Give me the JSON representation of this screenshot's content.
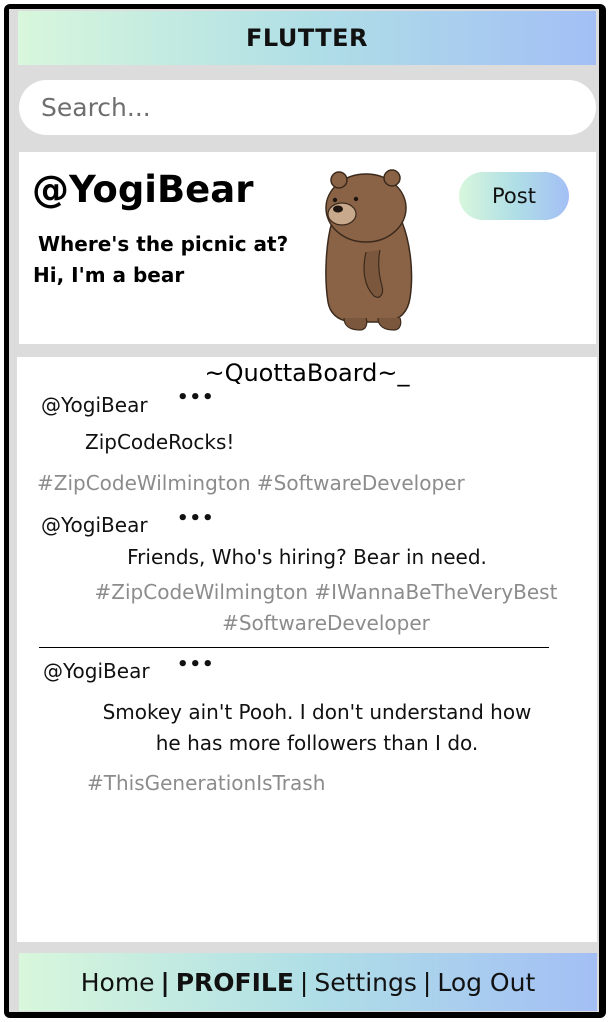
{
  "app": {
    "title": "FLUTTER"
  },
  "search": {
    "placeholder": "Search..."
  },
  "profile": {
    "handle": "@YogiBear",
    "bio_line1": "Where's the picnic at?",
    "bio_line2": "Hi, I'm a bear",
    "avatar_icon": "bear-illustration",
    "post_button": "Post"
  },
  "board": {
    "title": "~QuottaBoard~_",
    "posts": [
      {
        "user": "@YogiBear",
        "menu": "•••",
        "text": "ZipCodeRocks!",
        "tags": [
          "#ZipCodeWilmington",
          "#SoftwareDeveloper"
        ]
      },
      {
        "user": "@YogiBear",
        "menu": "•••",
        "text": "Friends, Who's hiring? Bear in need.",
        "tags": [
          "#ZipCodeWilmington",
          "#IWannaBeTheVeryBest",
          "#SoftwareDeveloper"
        ]
      },
      {
        "user": "@YogiBear",
        "menu": "•••",
        "text_line1": "Smokey ain't Pooh. I don't understand how",
        "text_line2": "he has more followers than I do.",
        "tags": [
          "#ThisGenerationIsTrash"
        ]
      }
    ]
  },
  "nav": {
    "home": "Home",
    "sep1": "|",
    "profile": "PROFILE",
    "sep2": "|",
    "settings": "Settings",
    "sep3": "|",
    "logout": "Log Out",
    "active": "PROFILE"
  },
  "colors": {
    "gradient_start": "#d8f7dc",
    "gradient_mid": "#b0dfe6",
    "gradient_end": "#a3bff5",
    "frame": "#000000",
    "background": "#dcdcdc",
    "tag_text": "#8c8c8c"
  }
}
